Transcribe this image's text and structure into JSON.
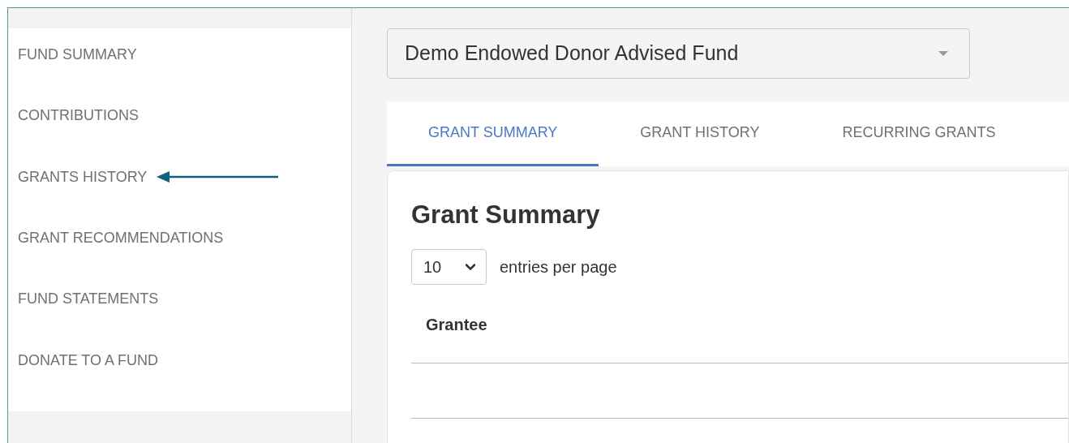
{
  "sidebar": {
    "items": [
      {
        "label": "FUND SUMMARY",
        "pointer": false
      },
      {
        "label": "CONTRIBUTIONS",
        "pointer": false
      },
      {
        "label": "GRANTS HISTORY",
        "pointer": true
      },
      {
        "label": "GRANT RECOMMENDATIONS",
        "pointer": false
      },
      {
        "label": "FUND STATEMENTS",
        "pointer": false
      },
      {
        "label": "DONATE TO A FUND",
        "pointer": false
      }
    ]
  },
  "fund_select": {
    "value": "Demo Endowed Donor Advised Fund"
  },
  "tabs": [
    {
      "label": "GRANT SUMMARY",
      "selected": true
    },
    {
      "label": "GRANT HISTORY",
      "selected": false
    },
    {
      "label": "RECURRING GRANTS",
      "selected": false
    }
  ],
  "card": {
    "title": "Grant Summary",
    "page_size": {
      "value": "10"
    },
    "page_size_label": "entries per page",
    "table": {
      "columns": [
        "Grantee"
      ]
    }
  }
}
